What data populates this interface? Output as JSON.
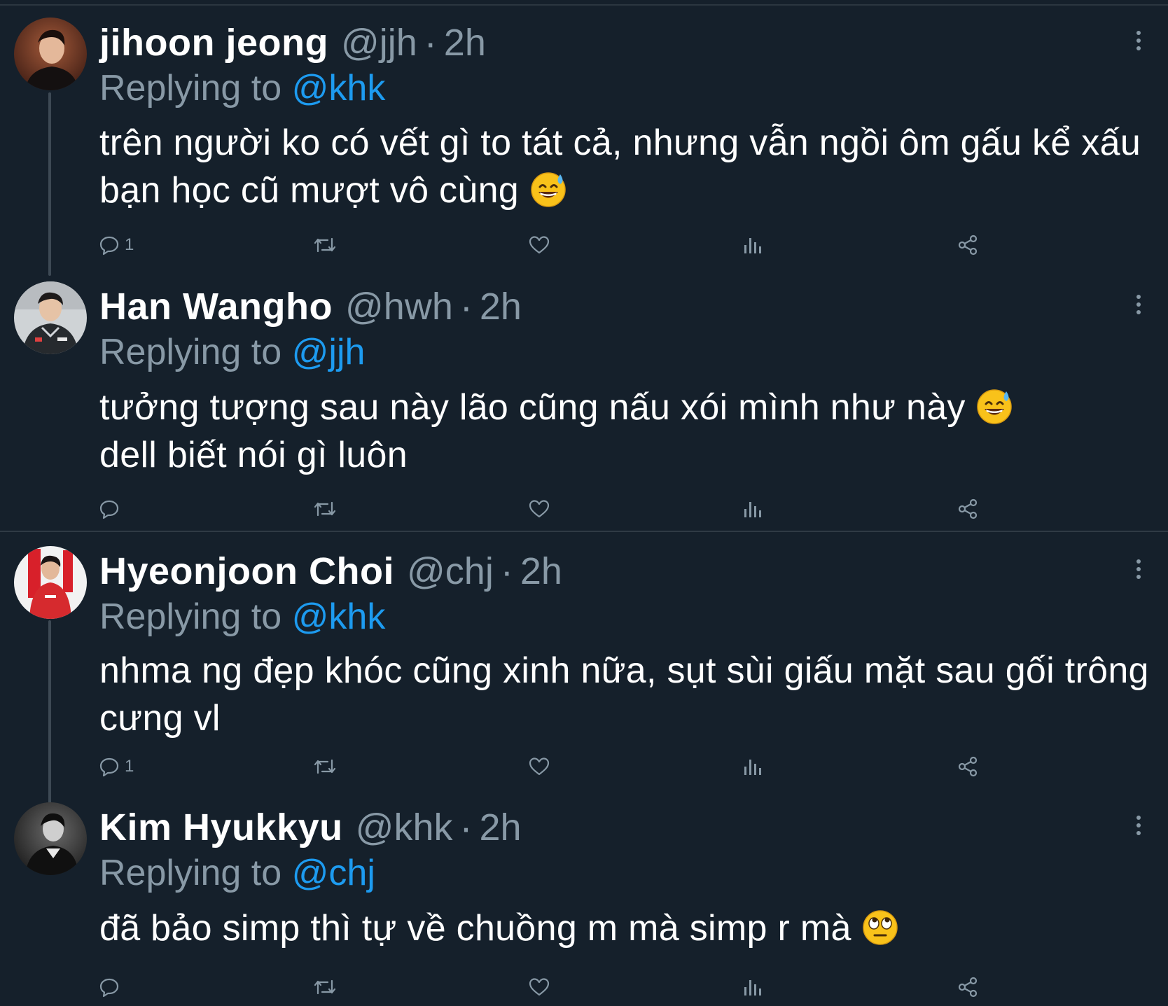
{
  "tweets": [
    {
      "name": "jihoon jeong",
      "handle": "@jjh",
      "separator": "·",
      "time": "2h",
      "replying_prefix": "Replying to",
      "replying_to": "@khk",
      "text": "trên người ko có vết gì to tát cả, nhưng vẫn ngồi ôm gấu kể xấu bạn học cũ mượt vô cùng",
      "emoji": "grinning-sweat-emoji",
      "reply_count": "1",
      "avatar": "avatar-dark-suit"
    },
    {
      "name": "Han Wangho",
      "handle": "@hwh",
      "separator": "·",
      "time": "2h",
      "replying_prefix": "Replying to",
      "replying_to": "@jjh",
      "text_line1": "tưởng tượng sau này lão cũng nấu xói mình như này",
      "text_line2": "dell biết nói gì luôn",
      "emoji": "grinning-sweat-emoji",
      "reply_count": "",
      "avatar": "avatar-jersey"
    },
    {
      "name": "Hyeonjoon Choi",
      "handle": "@chj",
      "separator": "·",
      "time": "2h",
      "replying_prefix": "Replying to",
      "replying_to": "@khk",
      "text": "nhma ng đẹp khóc cũng xinh nữa, sụt sùi giấu mặt sau gối trông cưng vl",
      "reply_count": "1",
      "avatar": "avatar-red-jersey"
    },
    {
      "name": "Kim Hyukkyu",
      "handle": "@khk",
      "separator": "·",
      "time": "2h",
      "replying_prefix": "Replying to",
      "replying_to": "@chj",
      "text": "đã bảo simp thì tự về chuồng m mà simp r mà",
      "emoji": "eye-roll-emoji",
      "reply_count": "",
      "avatar": "avatar-monochrome"
    }
  ],
  "icons": {
    "reply": "reply-icon",
    "retweet": "retweet-icon",
    "like": "heart-icon",
    "views": "views-icon",
    "share": "share-icon",
    "more": "more-vertical-icon"
  },
  "colors": {
    "background": "#15202b",
    "text": "#ffffff",
    "muted": "#8899a6",
    "accent": "#1d9bf0"
  }
}
